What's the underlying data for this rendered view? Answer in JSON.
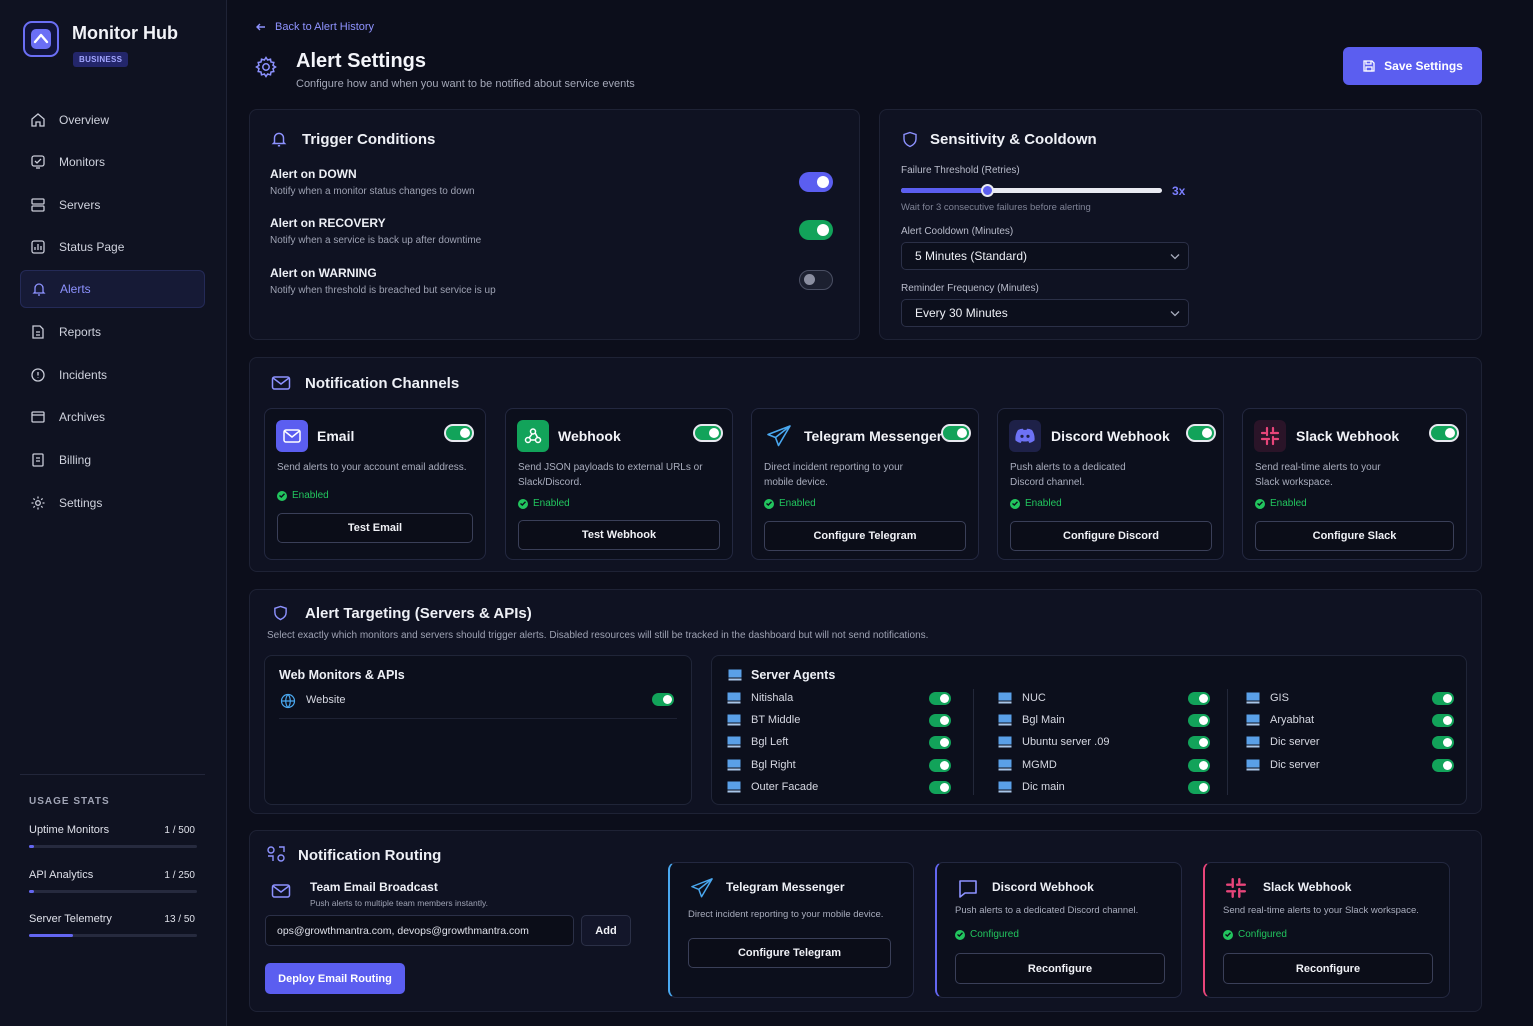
{
  "app": {
    "name": "Monitor Hub",
    "plan": "BUSINESS"
  },
  "nav": [
    {
      "label": "Overview",
      "icon": "home-icon"
    },
    {
      "label": "Monitors",
      "icon": "monitor-check-icon"
    },
    {
      "label": "Servers",
      "icon": "server-icon"
    },
    {
      "label": "Status Page",
      "icon": "status-grid-icon"
    },
    {
      "label": "Alerts",
      "icon": "bell-icon",
      "active": true
    },
    {
      "label": "Reports",
      "icon": "report-icon"
    },
    {
      "label": "Incidents",
      "icon": "alert-circle-icon"
    },
    {
      "label": "Archives",
      "icon": "archive-icon"
    },
    {
      "label": "Billing",
      "icon": "billing-icon"
    },
    {
      "label": "Settings",
      "icon": "gear-icon"
    }
  ],
  "usage": {
    "title": "USAGE STATS",
    "items": [
      {
        "label": "Uptime Monitors",
        "value": "1 / 500",
        "fraction": 0.002
      },
      {
        "label": "API Analytics",
        "value": "1 / 250",
        "fraction": 0.004
      },
      {
        "label": "Server Telemetry",
        "value": "13 / 50",
        "fraction": 0.26
      }
    ]
  },
  "header": {
    "back": "Back to Alert History",
    "title": "Alert Settings",
    "subtitle": "Configure how and when you want to be notified about service events",
    "save": "Save Settings"
  },
  "trigger": {
    "title": "Trigger Conditions",
    "items": [
      {
        "label": "Alert on DOWN",
        "desc": "Notify when a monitor status changes to down",
        "on": true
      },
      {
        "label": "Alert on RECOVERY",
        "desc": "Notify when a service is back up after downtime",
        "on": true
      },
      {
        "label": "Alert on WARNING",
        "desc": "Notify when threshold is breached but service is up",
        "on": false
      }
    ]
  },
  "sensitivity": {
    "title": "Sensitivity & Cooldown",
    "threshold_label": "Failure Threshold (Retries)",
    "threshold_value": "3x",
    "threshold_fraction": 0.33,
    "threshold_hint": "Wait for 3 consecutive failures before alerting",
    "cooldown_label": "Alert Cooldown (Minutes)",
    "cooldown_value": "5 Minutes (Standard)",
    "reminder_label": "Reminder Frequency (Minutes)",
    "reminder_value": "Every 30 Minutes"
  },
  "channels": {
    "title": "Notification Channels",
    "items": [
      {
        "name": "Email",
        "desc": "Send alerts to your account email address.",
        "status": "Enabled",
        "button": "Test Email"
      },
      {
        "name": "Webhook",
        "desc": "Send JSON payloads to external URLs or Slack/Discord.",
        "status": "Enabled",
        "button": "Test Webhook"
      },
      {
        "name": "Telegram Messenger",
        "desc": "Direct incident reporting to your mobile device.",
        "status": "Enabled",
        "button": "Configure Telegram"
      },
      {
        "name": "Discord Webhook",
        "desc": "Push alerts to a dedicated Discord channel.",
        "status": "Enabled",
        "button": "Configure Discord"
      },
      {
        "name": "Slack Webhook",
        "desc": "Send real-time alerts to your Slack workspace.",
        "status": "Enabled",
        "button": "Configure Slack"
      }
    ]
  },
  "targeting": {
    "title": "Alert Targeting (Servers & APIs)",
    "desc": "Select exactly which monitors and servers should trigger alerts. Disabled resources will still be tracked in the dashboard but will not send notifications.",
    "web_title": "Web Monitors & APIs",
    "web_items": [
      "Website"
    ],
    "server_title": "Server Agents",
    "col1": [
      "Nitishala",
      "BT Middle",
      "Bgl Left",
      "Bgl Right",
      "Outer Facade"
    ],
    "col2": [
      "NUC",
      "Bgl Main",
      "Ubuntu server .09",
      "MGMD",
      "Dic main"
    ],
    "col3": [
      "GIS",
      "Aryabhat",
      "Dic server",
      "Dic server"
    ]
  },
  "routing": {
    "title": "Notification Routing",
    "email_title": "Team Email Broadcast",
    "email_desc": "Push alerts to multiple team members instantly.",
    "email_value": "ops@growthmantra.com, devops@growthmantra.com",
    "add": "Add",
    "deploy": "Deploy Email Routing",
    "cards": [
      {
        "name": "Telegram Messenger",
        "desc": "Direct incident reporting to your mobile device.",
        "status": "",
        "button": "Configure Telegram"
      },
      {
        "name": "Discord Webhook",
        "desc": "Push alerts to a dedicated Discord channel.",
        "status": "Configured",
        "button": "Reconfigure"
      },
      {
        "name": "Slack Webhook",
        "desc": "Send real-time alerts to your Slack workspace.",
        "status": "Configured",
        "button": "Reconfigure"
      }
    ]
  },
  "colors": {
    "accent": "#5b5ef0",
    "success": "#22c55e",
    "toggle_green": "#12a35a",
    "bg": "#0c0e1b"
  }
}
